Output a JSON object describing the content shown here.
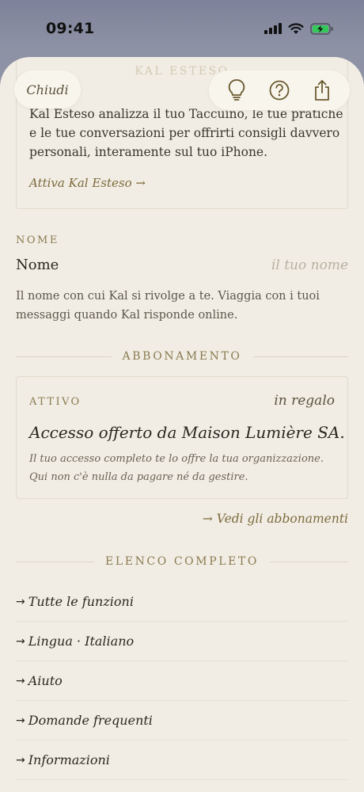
{
  "status_bar": {
    "time": "09:41"
  },
  "sheet": {
    "title": "KAL ESTESO",
    "close_label": "Chiudi"
  },
  "toolbar": {
    "icons": [
      "lightbulb-icon",
      "help-icon",
      "share-icon"
    ]
  },
  "extended": {
    "description": "Kal Esteso analizza il tuo Taccuino, le tue pratiche e le tue conversazioni per offrirti consigli davvero personali, interamente sul tuo iPhone.",
    "activate_link": "Attiva Kal Esteso →"
  },
  "name_section": {
    "heading": "NOME",
    "field_label": "Nome",
    "placeholder": "il tuo nome",
    "help": "Il nome con cui Kal si rivolge a te. Viaggia con i tuoi messaggi quando Kal risponde online."
  },
  "subscription": {
    "heading": "ABBONAMENTO",
    "status": "ATTIVO",
    "badge": "in regalo",
    "headline": "Accesso offerto da Maison Lumière SA.",
    "note": "Il tuo accesso completo te lo offre la tua organizzazione. Qui non c'è nulla da pagare né da gestire.",
    "plans_link": "→ Vedi gli abbonamenti"
  },
  "full_list": {
    "heading": "ELENCO COMPLETO",
    "items": [
      {
        "label": "Tutte le funzioni"
      },
      {
        "label": "Lingua · Italiano"
      },
      {
        "label": "Aiuto"
      },
      {
        "label": "Domande frequenti"
      },
      {
        "label": "Informazioni"
      }
    ]
  },
  "colors": {
    "sheet_background": "#f1ede4",
    "accent_gold": "#8a7a50",
    "battery_green": "#34c759"
  }
}
